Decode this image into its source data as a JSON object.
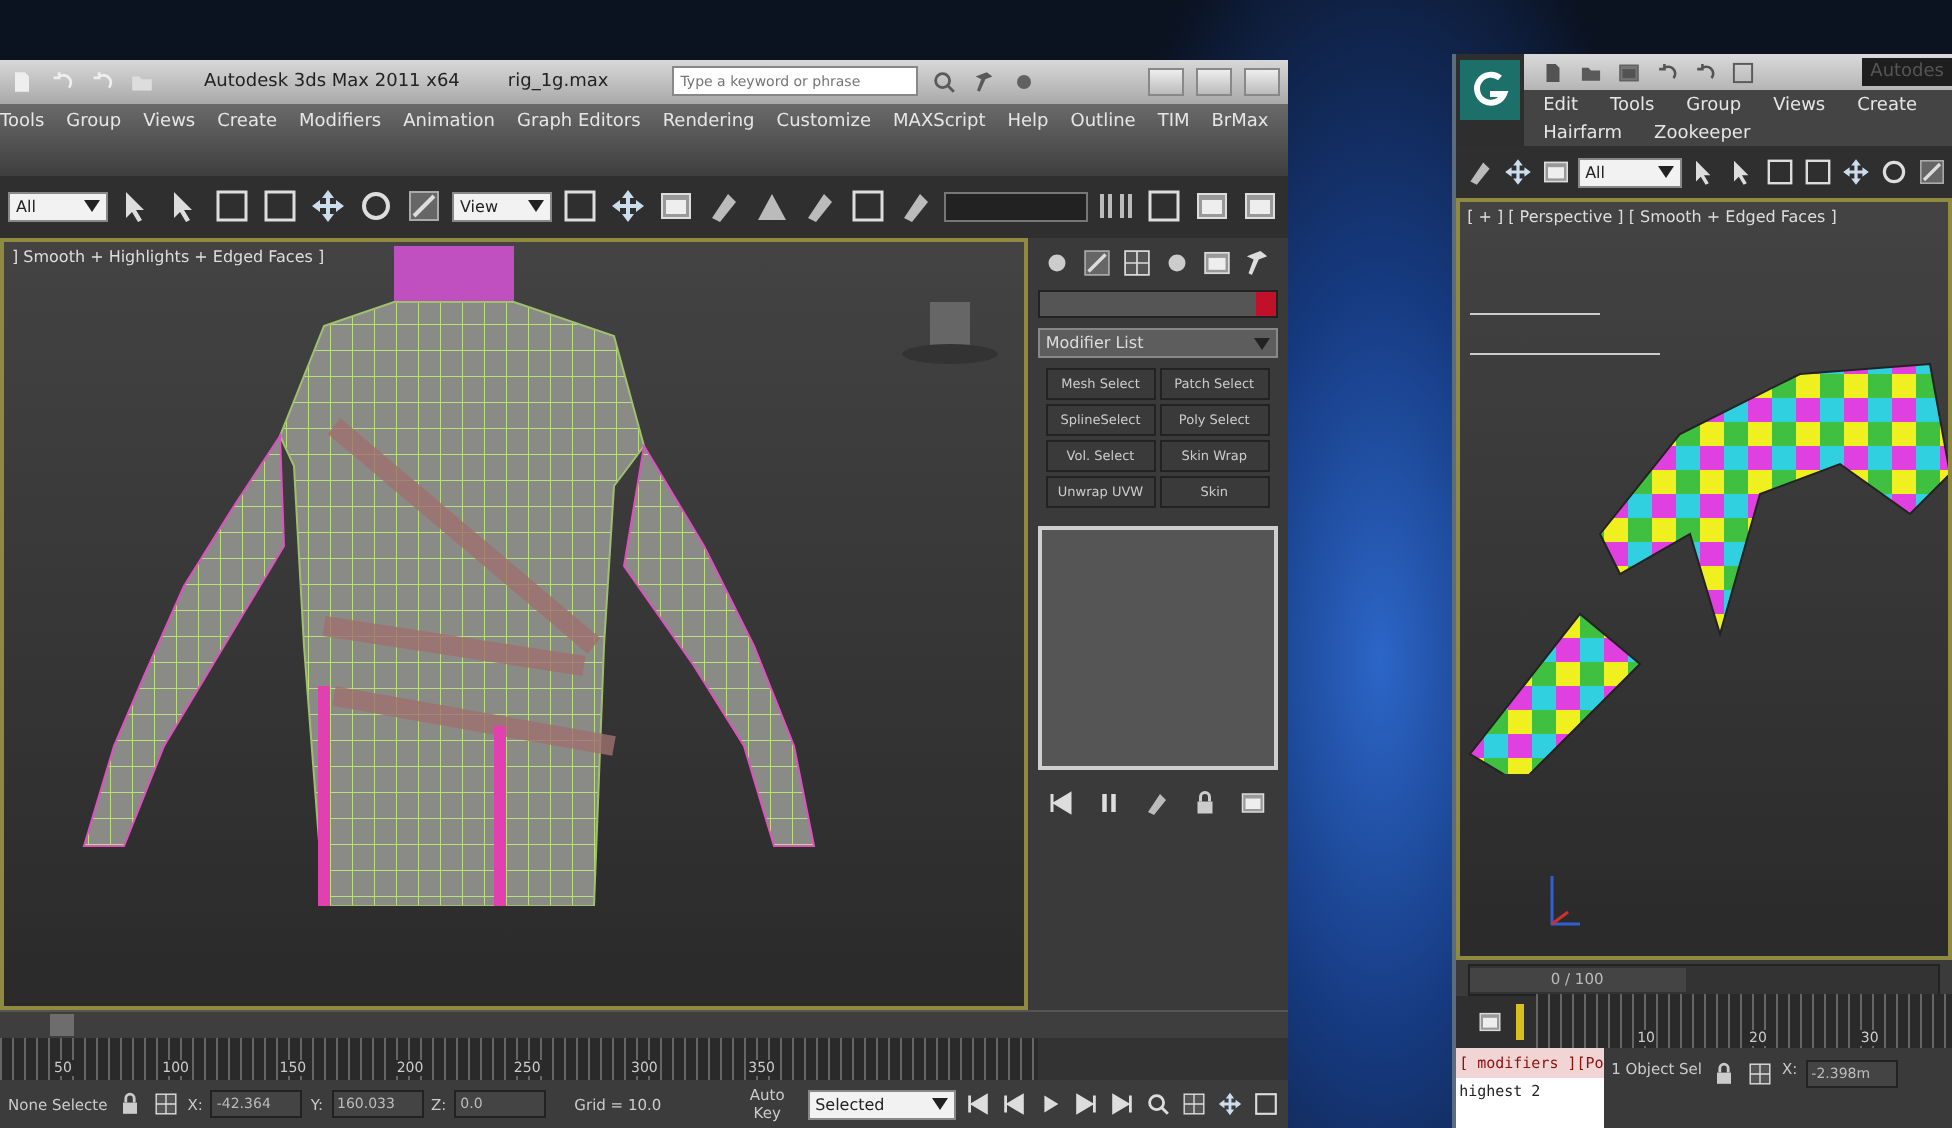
{
  "left_window": {
    "title": "Autodesk 3ds Max  2011 x64",
    "file": "rig_1g.max",
    "search": {
      "placeholder": "Type a keyword or phrase"
    },
    "menu": [
      "Tools",
      "Group",
      "Views",
      "Create",
      "Modifiers",
      "Animation",
      "Graph Editors",
      "Rendering",
      "Customize",
      "MAXScript",
      "Help",
      "Outline",
      "TIM",
      "BrMax"
    ],
    "toolbar": {
      "selection_filter": "All",
      "coordinate_system": "View"
    },
    "viewport": {
      "label": "] Smooth + Highlights + Edged Faces ]"
    },
    "command_panel": {
      "modifier_list": "Modifier List",
      "modifiers": [
        "Mesh Select",
        "Patch Select",
        "SplineSelect",
        "Poly Select",
        "Vol. Select",
        "Skin Wrap",
        "Unwrap UVW",
        "Skin"
      ]
    },
    "time_slider": {
      "level": 0
    },
    "time_ruler": {
      "ticks": [
        "50",
        "100",
        "150",
        "200",
        "250",
        "300",
        "350"
      ]
    },
    "status_bar": {
      "selection": "None Selecte",
      "coords": [
        {
          "label": "X:",
          "value": "-42.364"
        },
        {
          "label": "Y:",
          "value": "160.033"
        },
        {
          "label": "Z:",
          "value": "0.0"
        }
      ],
      "grid": "Grid = 10.0",
      "auto_key": "Auto Key",
      "key_filter": "Selected"
    }
  },
  "right_window": {
    "title": "Autodes",
    "menu": [
      [
        "Edit",
        "Tools",
        "Group",
        "Views",
        "Create"
      ],
      [
        "Hairfarm",
        "Zookeeper"
      ]
    ],
    "toolbar": {
      "selection_filter": "All"
    },
    "viewport": {
      "label": "[ + ] [ Perspective ] [ Smooth + Edged Faces ]"
    },
    "time_slider": {
      "text": "0 / 100",
      "level": 0
    },
    "time_ruler": {
      "ticks": [
        "10",
        "20",
        "30"
      ]
    },
    "status_bar": {
      "selection": "1 Object Sel",
      "coords": [
        {
          "label": "X:",
          "value": "-2.398m"
        }
      ]
    },
    "panel": {
      "header": "[ modifiers ][Po",
      "line": "highest  2"
    }
  }
}
